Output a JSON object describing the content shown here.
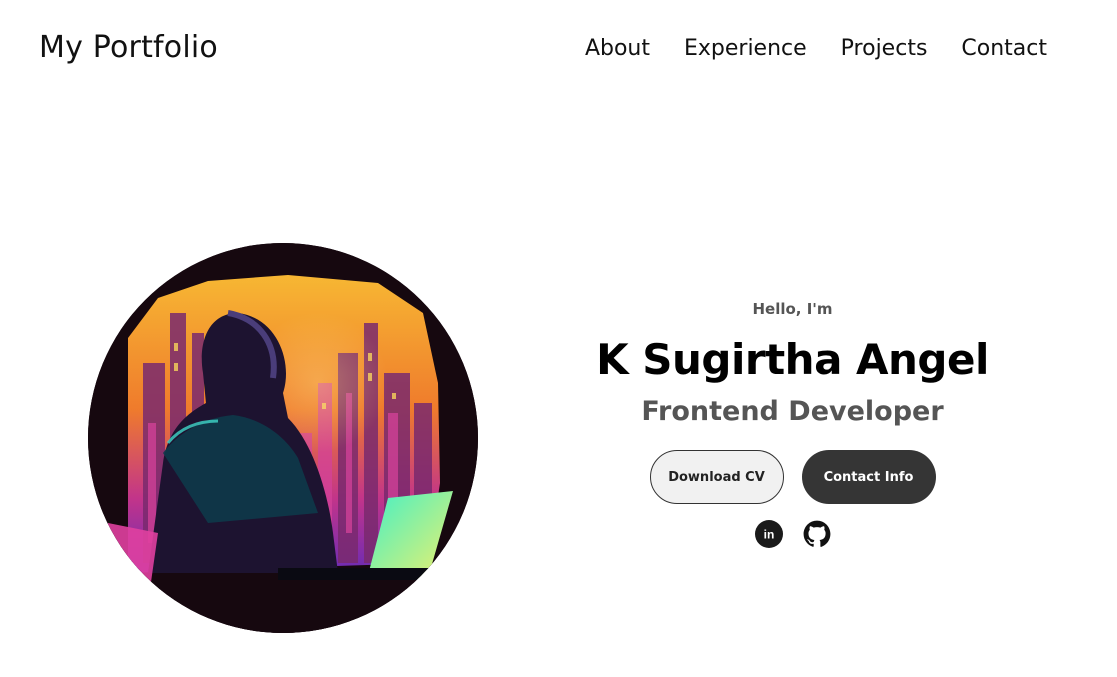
{
  "nav": {
    "logo": "My Portfolio",
    "links": [
      "About",
      "Experience",
      "Projects",
      "Contact"
    ]
  },
  "hero": {
    "greeting": "Hello, I'm",
    "name": "K Sugirtha Angel",
    "role": "Frontend Developer",
    "buttons": {
      "download_cv": "Download CV",
      "contact_info": "Contact Info"
    },
    "socials": {
      "linkedin_glyph": "in",
      "linkedin_icon": "linkedin-icon",
      "github_icon": "github-icon"
    },
    "profile_image": "illustration-girl-with-laptop-city-night"
  },
  "colors": {
    "text": "#111111",
    "muted": "#555555",
    "button_dark": "#353535",
    "button_light": "#f1f1f1"
  }
}
